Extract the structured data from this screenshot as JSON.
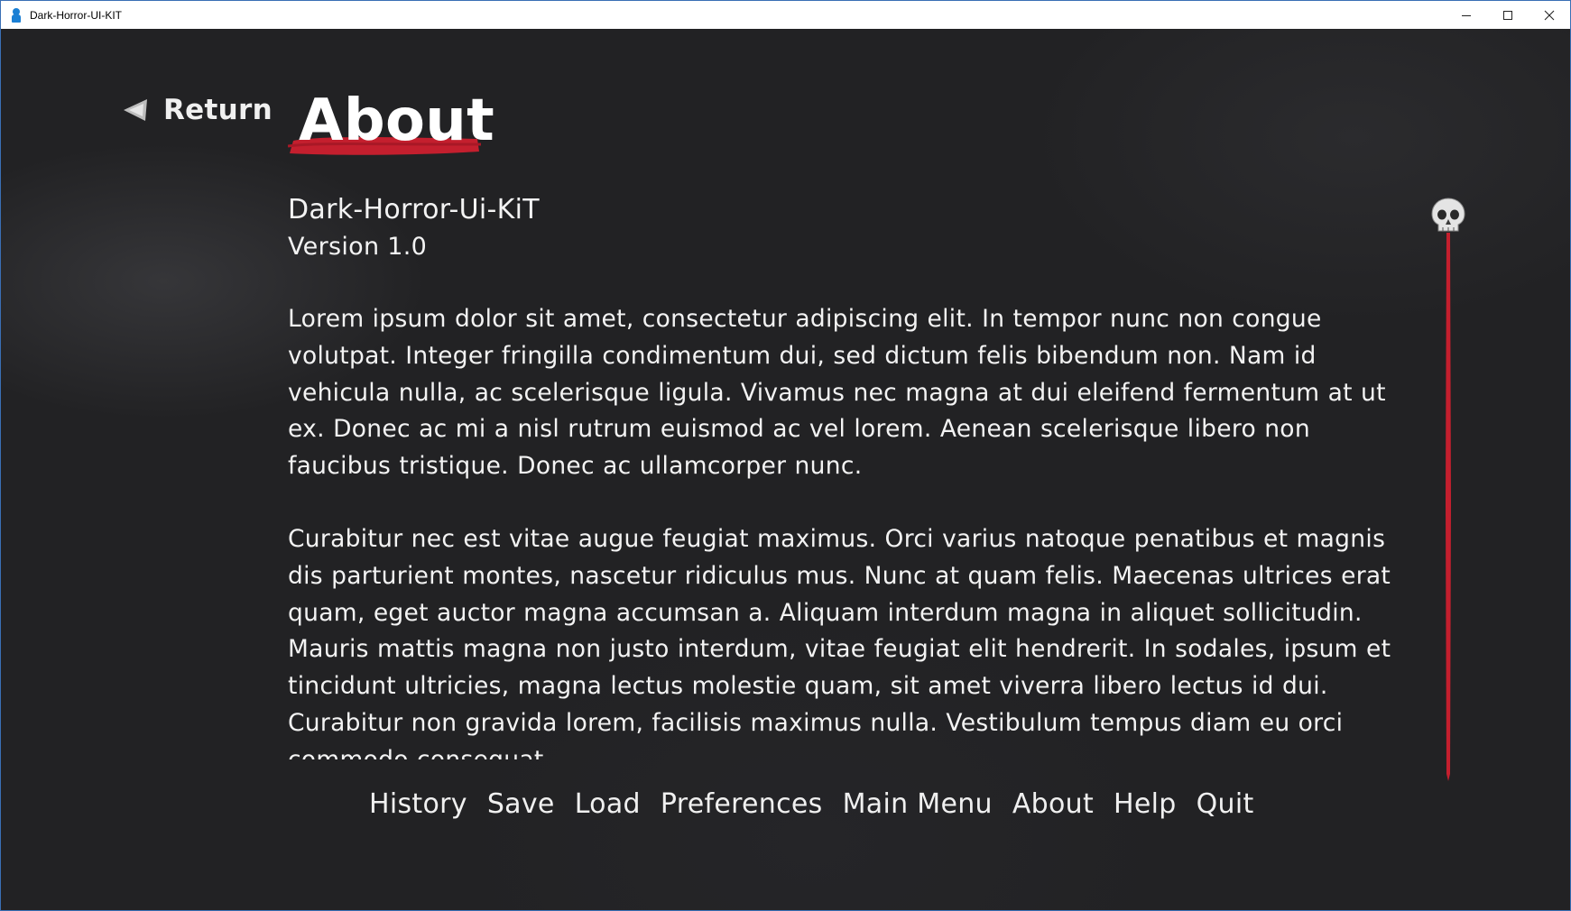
{
  "window": {
    "title": "Dark-Horror-UI-KIT",
    "controls": {
      "minimize": "minimize-icon",
      "maximize": "maximize-icon",
      "close": "close-icon"
    }
  },
  "header": {
    "return_label": "Return",
    "page_title": "About"
  },
  "about": {
    "name": "Dark-Horror-Ui-KiT",
    "version": "Version 1.0",
    "paragraphs": [
      "Lorem ipsum dolor sit amet, consectetur adipiscing elit. In tempor nunc non congue volutpat. Integer fringilla condimentum dui, sed dictum felis bibendum non. Nam id vehicula nulla, ac scelerisque ligula. Vivamus nec magna at dui eleifend fermentum at ut ex. Donec ac mi a nisl rutrum euismod ac vel lorem. Aenean scelerisque libero non faucibus tristique. Donec ac ullamcorper nunc.",
      "Curabitur nec est vitae augue feugiat maximus. Orci varius natoque penatibus et magnis dis parturient montes, nascetur ridiculus mus. Nunc at quam felis. Maecenas ultrices erat quam, eget auctor magna accumsan a. Aliquam interdum magna in aliquet sollicitudin. Mauris mattis magna non justo interdum, vitae feugiat elit hendrerit. In sodales, ipsum et tincidunt ultricies, magna lectus molestie quam, sit amet viverra libero lectus id dui. Curabitur non gravida lorem, facilisis maximus nulla. Vestibulum tempus diam eu orci commodo consequat."
    ]
  },
  "scrollbar": {
    "thumb_icon": "skull-icon",
    "track_color": "#c41f2e",
    "position": 0.0
  },
  "menu": {
    "items": [
      "History",
      "Save",
      "Load",
      "Preferences",
      "Main Menu",
      "About",
      "Help",
      "Quit"
    ]
  },
  "colors": {
    "accent": "#c41f2e",
    "text": "#f3f3f3",
    "background": "#222224"
  }
}
